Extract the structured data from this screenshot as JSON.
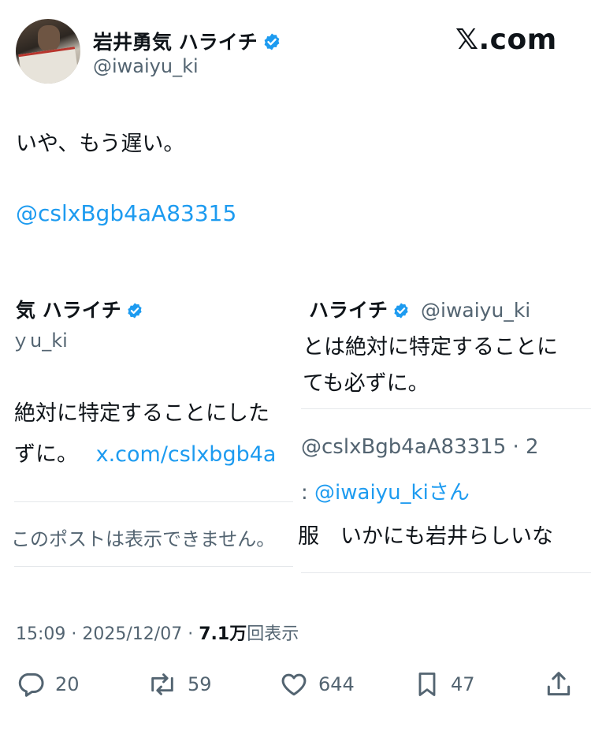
{
  "header": {
    "display_name": "岩井勇気 ハライチ",
    "handle": "@iwaiyu_ki",
    "logo": "𝕏.com"
  },
  "post": {
    "text": "いや、もう遅い。",
    "mention": "@cslxBgb4aA83315"
  },
  "left_card": {
    "name_fragment": "気 ハライチ",
    "handle_fragment": "ｙu_ki",
    "text_line1": "絶対に特定することにした",
    "text_line2_prefix": "ずに。",
    "text_line2_link": "x.com/cslxbgb4a",
    "unavailable": "このポストは表示できません。"
  },
  "right_card": {
    "name_fragment": "ハライチ",
    "handle_fragment": "@iwaiyu_ki",
    "text_line1": "とは絶対に特定することに",
    "text_line2": "ても必ずに。",
    "reply_user": "@cslxBgb4aA83315 · 2",
    "reply_to_prefix": ":",
    "reply_to_handle": "@iwaiyu_kiさん",
    "reply_text": "服　いかにも岩井らしいな"
  },
  "meta": {
    "time": "15:09",
    "date": "2025/12/07",
    "views_count": "7.1万",
    "views_label": "回表示"
  },
  "actions": {
    "replies": "20",
    "reposts": "59",
    "likes": "644",
    "bookmarks": "47"
  },
  "colors": {
    "accent": "#1d9bf0",
    "muted": "#536471",
    "text": "#0f1419"
  },
  "icons": [
    "verified-badge-icon",
    "reply-icon",
    "repost-icon",
    "like-icon",
    "bookmark-icon",
    "share-icon"
  ]
}
